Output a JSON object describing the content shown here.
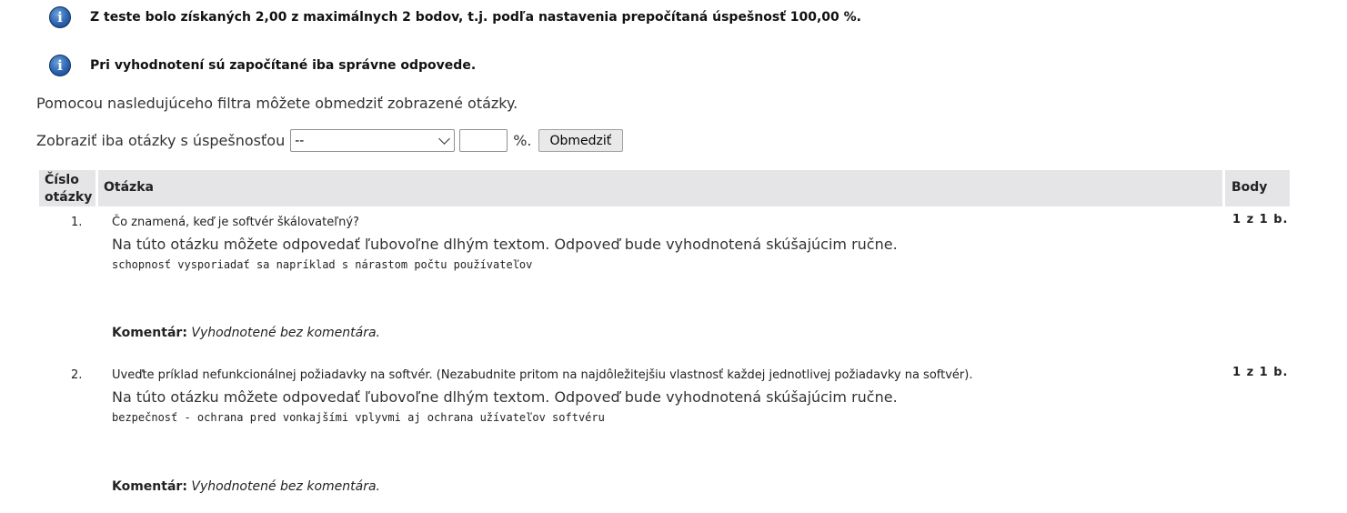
{
  "info": [
    {
      "icon": "info-icon",
      "text": "Z teste bolo získaných 2,00 z maximálnych 2 bodov, t.j. podľa nastavenia prepočítaná úspešnosť 100,00 %."
    },
    {
      "icon": "info-icon",
      "text": "Pri vyhodnotení sú započítané iba správne odpovede."
    }
  ],
  "filter": {
    "intro": "Pomocou nasledujúceho filtra môžete obmedziť zobrazené otázky.",
    "label": "Zobraziť iba otázky s úspešnosťou",
    "select_value": "--",
    "input_value": "",
    "percent": "%.",
    "button": "Obmedziť"
  },
  "table": {
    "headers": {
      "number_line1": "Číslo",
      "number_line2": "otázky",
      "question": "Otázka",
      "points": "Body"
    },
    "rows": [
      {
        "number": "1.",
        "question": "Čo znamená, keď je softvér škálovateľný?",
        "info": "Na túto otázku môžete odpovedať ľubovoľne dlhým textom. Odpoveď bude vyhodnotená skúšajúcim ručne.",
        "answer": "schopnosť vysporiadať sa napríklad s nárastom počtu používateľov",
        "points": "1 z 1 b.",
        "comment_label": "Komentár:",
        "comment": "Vyhodnotené bez komentára."
      },
      {
        "number": "2.",
        "question": "Uveďte príklad nefunkcionálnej požiadavky na softvér. (Nezabudnite pritom na najdôležitejšiu vlastnosť každej jednotlivej požiadavky na softvér).",
        "info": "Na túto otázku môžete odpovedať ľubovoľne dlhým textom. Odpoveď bude vyhodnotená skúšajúcim ručne.",
        "answer": "bezpečnosť - ochrana pred vonkajšími vplyvmi aj ochrana užívateľov softvéru",
        "points": "1 z 1 b.",
        "comment_label": "Komentár:",
        "comment": "Vyhodnotené bez komentára."
      }
    ]
  }
}
